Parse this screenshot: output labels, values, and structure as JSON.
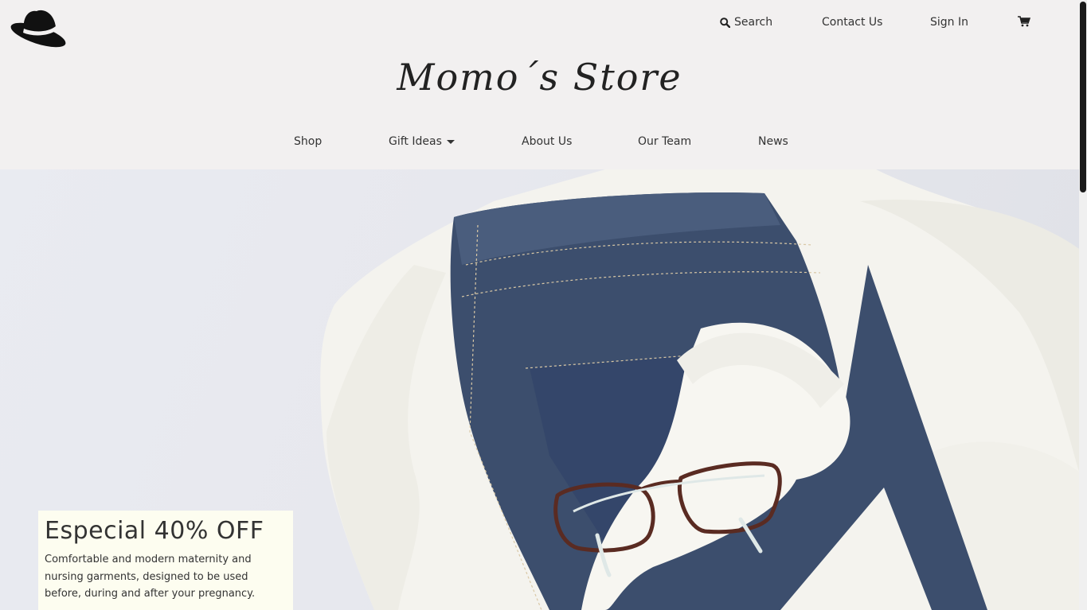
{
  "header": {
    "brand": "Momo´s Store",
    "top_nav": {
      "search_label": "Search",
      "contact_label": "Contact Us",
      "signin_label": "Sign In"
    },
    "main_nav": [
      {
        "label": "Shop"
      },
      {
        "label": "Gift Ideas"
      },
      {
        "label": "About Us"
      },
      {
        "label": "Our Team"
      },
      {
        "label": "News"
      }
    ]
  },
  "icons": {
    "logo": "hat-icon",
    "search": "search-icon",
    "cart": "cart-icon",
    "dropdown": "caret-down-icon"
  },
  "promo": {
    "title": "Especial 40% OFF",
    "text": "Comfortable and modern maternity and nursing garments, designed to be used before, during and after your pregnancy."
  },
  "colors": {
    "header_bg": "#f2f0f0",
    "promo_bg": "#fdfdf0",
    "text": "#333333"
  }
}
